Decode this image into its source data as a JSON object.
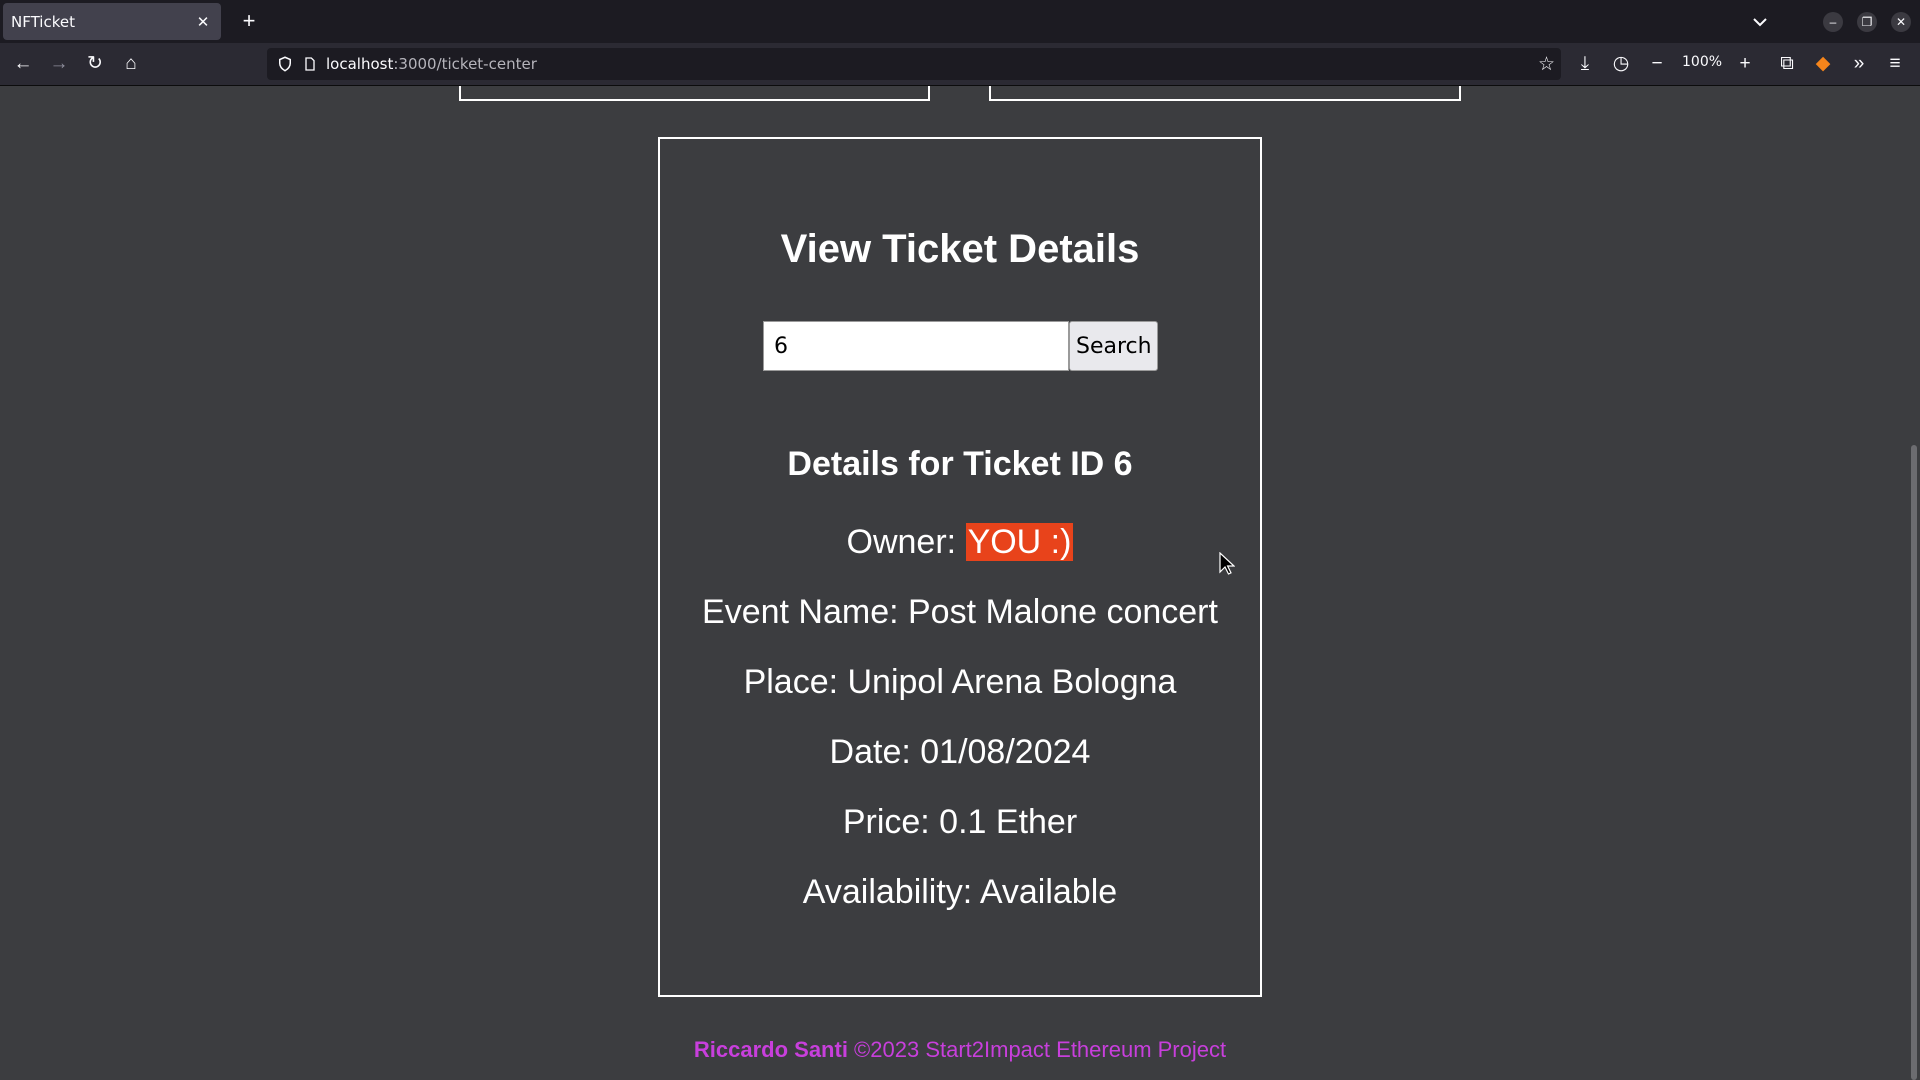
{
  "browser": {
    "tab_title": "NFTicket",
    "url_host": "localhost",
    "url_path": ":3000/ticket-center",
    "zoom": "100%"
  },
  "page": {
    "heading": "View Ticket Details",
    "search": {
      "value": "6",
      "button_label": "Search"
    },
    "details_heading": "Details for Ticket ID 6",
    "owner_label": "Owner: ",
    "owner_value": "YOU :)",
    "event_name": "Event Name: Post Malone concert",
    "place": "Place: Unipol Arena Bologna",
    "date": "Date: 01/08/2024",
    "price": "Price: 0.1 Ether",
    "availability": "Availability: Available"
  },
  "footer": {
    "author": "Riccardo Santi",
    "text": " ©2023 Start2Impact Ethereum Project"
  },
  "colors": {
    "page_bg": "#3c3d40",
    "owner_highlight": "#e8431b",
    "footer_text": "#c83fdc"
  }
}
